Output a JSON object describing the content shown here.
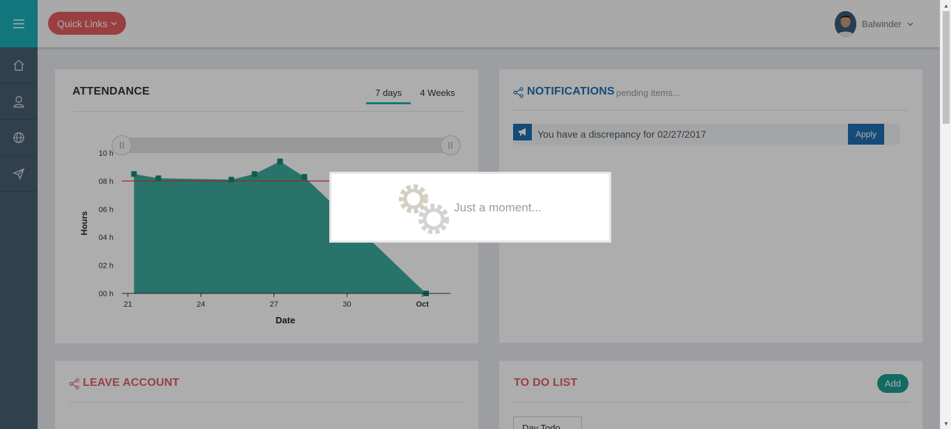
{
  "header": {
    "quick_links": "Quick Links",
    "user_name": "Balwinder"
  },
  "sidebar": {
    "items": [
      {
        "icon": "home-icon"
      },
      {
        "icon": "user-icon"
      },
      {
        "icon": "globe-icon"
      },
      {
        "icon": "send-icon"
      }
    ]
  },
  "attendance": {
    "title": "ATTENDANCE",
    "tabs": [
      "7 days",
      "4 Weeks"
    ],
    "active_tab": "7 days"
  },
  "notifications": {
    "title": "NOTIFICATIONS",
    "subtitle": "pending items...",
    "items": [
      {
        "text": "You have a discrepancy for 02/27/2017",
        "action": "Apply"
      }
    ]
  },
  "leave_account": {
    "title": "LEAVE ACCOUNT"
  },
  "todo": {
    "title": "TO DO LIST",
    "add_label": "Add",
    "first_tab": "Day Todo"
  },
  "loading": {
    "text": "Just a moment..."
  },
  "colors": {
    "accent": "#1ab0b8",
    "brand_red": "#e35d61",
    "blue": "#1f6fb3",
    "area": "#1a9e8c",
    "target_line": "#e53935"
  },
  "chart_data": {
    "type": "area",
    "xlabel": "Date",
    "ylabel": "Hours",
    "x_ticks": [
      "21",
      "24",
      "27",
      "30",
      "Oct"
    ],
    "y_ticks": [
      "00 h",
      "02 h",
      "04 h",
      "06 h",
      "08 h",
      "10 h"
    ],
    "ylim": [
      0,
      10
    ],
    "points": [
      {
        "day": 21.25,
        "hours": 8.5
      },
      {
        "day": 22.25,
        "hours": 8.2
      },
      {
        "day": 25.25,
        "hours": 8.1
      },
      {
        "day": 26.2,
        "hours": 8.5
      },
      {
        "day": 27.25,
        "hours": 9.4
      },
      {
        "day": 28.25,
        "hours": 8.3
      },
      {
        "day": 33.25,
        "hours": 0
      }
    ],
    "target_line": 8,
    "grid": false
  }
}
